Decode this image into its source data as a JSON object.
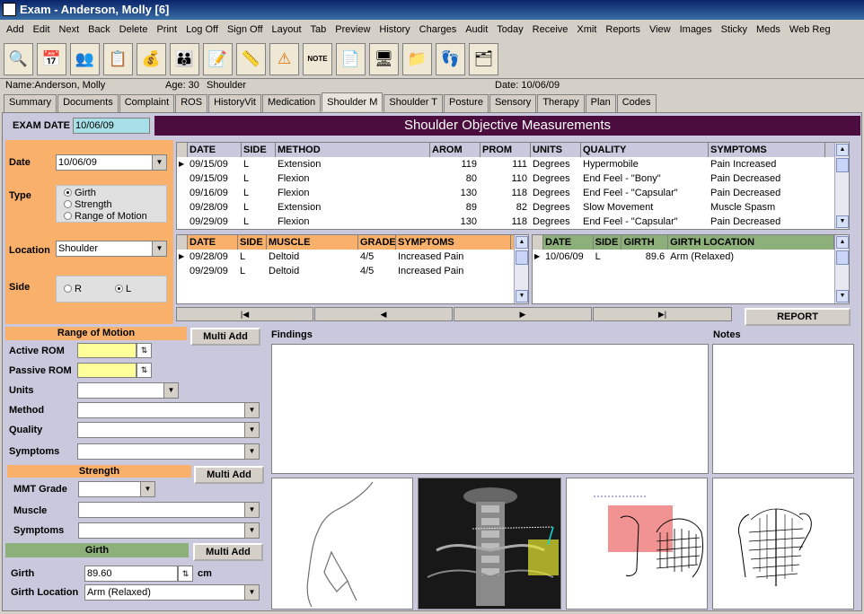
{
  "window": {
    "title": "Exam - Anderson, Molly [6]"
  },
  "menu": [
    "Add",
    "Edit",
    "Next",
    "Back",
    "Delete",
    "Print",
    "Log Off",
    "Sign Off",
    "Layout",
    "Tab",
    "Preview",
    "History",
    "Charges",
    "Audit",
    "Today",
    "Receive",
    "Xmit",
    "Reports",
    "View",
    "Images",
    "Sticky",
    "Meds",
    "Web Reg"
  ],
  "toolbar": {
    "icons": [
      "search-icon",
      "calendar-icon",
      "people-icon",
      "checklist-icon",
      "money-bag-icon",
      "family-icon",
      "notepad-icon",
      "ruler-icon",
      "warning-icon",
      "note-icon",
      "document-icon",
      "computer-icon",
      "folder-icon",
      "footprints-icon",
      "files-icon"
    ],
    "note_label": "NOTE"
  },
  "patient": {
    "name": "Name:Anderson, Molly",
    "age": "Age: 30",
    "region": "Shoulder",
    "date": "Date: 10/06/09"
  },
  "tabs": [
    "Summary",
    "Documents",
    "Complaint",
    "ROS",
    "HistoryVit",
    "Medication",
    "Shoulder M",
    "Shoulder T",
    "Posture",
    "Sensory",
    "Therapy",
    "Plan",
    "Codes"
  ],
  "exam": {
    "date_label": "EXAM DATE",
    "date_value": "10/06/09",
    "heading": "Shoulder Objective Measurements"
  },
  "filters": {
    "date_label": "Date",
    "date_value": "10/06/09",
    "type_label": "Type",
    "type_options": [
      "Girth",
      "Strength",
      "Range of Motion"
    ],
    "location_label": "Location",
    "location_value": "Shoulder",
    "side_label": "Side",
    "side_r": "R",
    "side_l": "L"
  },
  "rom_grid": {
    "headers": [
      "DATE",
      "SIDE",
      "METHOD",
      "AROM",
      "PROM",
      "UNITS",
      "QUALITY",
      "SYMPTOMS"
    ],
    "rows": [
      [
        "09/15/09",
        "L",
        "Extension",
        "119",
        "111",
        "Degrees",
        "Hypermobile",
        "Pain Increased"
      ],
      [
        "09/15/09",
        "L",
        "Flexion",
        "80",
        "110",
        "Degrees",
        "End Feel - \"Bony\"",
        "Pain Decreased"
      ],
      [
        "09/16/09",
        "L",
        "Flexion",
        "130",
        "118",
        "Degrees",
        "End Feel - \"Capsular\"",
        "Pain Decreased"
      ],
      [
        "09/28/09",
        "L",
        "Extension",
        "89",
        "82",
        "Degrees",
        "Slow Movement",
        "Muscle Spasm"
      ],
      [
        "09/29/09",
        "L",
        "Flexion",
        "130",
        "118",
        "Degrees",
        "End Feel - \"Capsular\"",
        "Pain Decreased"
      ]
    ]
  },
  "strength_grid": {
    "headers": [
      "DATE",
      "SIDE",
      "MUSCLE",
      "GRADE",
      "SYMPTOMS"
    ],
    "rows": [
      [
        "09/28/09",
        "L",
        "Deltoid",
        "4/5",
        "Increased Pain"
      ],
      [
        "09/29/09",
        "L",
        "Deltoid",
        "4/5",
        "Increased Pain"
      ]
    ]
  },
  "girth_grid": {
    "headers": [
      "DATE",
      "SIDE",
      "GIRTH",
      "GIRTH LOCATION"
    ],
    "rows": [
      [
        "10/06/09",
        "L",
        "89.6",
        "Arm (Relaxed)"
      ]
    ]
  },
  "nav": {
    "first": "|◀",
    "prev": "◀",
    "next": "▶",
    "last": "▶|"
  },
  "report_button": "REPORT",
  "rom": {
    "title": "Range of Motion",
    "multi_add": "Multi Add",
    "active": "Active ROM",
    "passive": "Passive ROM",
    "units": "Units",
    "method": "Method",
    "quality": "Quality",
    "symptoms": "Symptoms"
  },
  "strength": {
    "title": "Strength",
    "multi_add": "Multi Add",
    "mmt": "MMT Grade",
    "muscle": "Muscle",
    "symptoms": "Symptoms"
  },
  "girth": {
    "title": "Girth",
    "multi_add": "Multi Add",
    "girth_label": "Girth",
    "girth_value": "89.60",
    "unit": "cm",
    "location_label": "Girth Location",
    "location_value": "Arm (Relaxed)"
  },
  "findings_label": "Findings",
  "notes_label": "Notes"
}
